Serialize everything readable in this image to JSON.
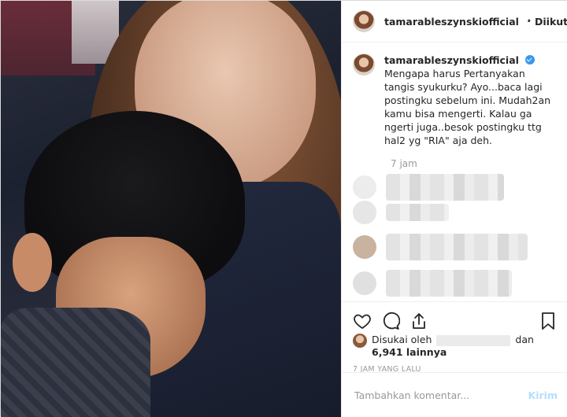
{
  "post": {
    "username": "tamarableszynskiofficial",
    "follow_label": "Diikuti",
    "dot": "•",
    "caption": "Mengapa harus Pertanyakan tangis syukurku? Ayo...baca lagi postingku sebelum ini. Mudah2an kamu bisa mengerti. Kalau ga ngerti juga..besok postingku ttg hal2 yg \"RIA\" aja deh.",
    "caption_time": "7 jam",
    "likes_prefix": "Disukai oleh",
    "likes_mid": "dan",
    "likes_count": "6,941 lainnya",
    "post_time": "7 JAM YANG LALU",
    "comment_placeholder": "Tambahkan komentar...",
    "post_button": "Kirim"
  },
  "icons": {
    "verified": "verified-badge-icon",
    "like": "heart-icon",
    "comment": "comment-icon",
    "share": "share-icon",
    "save": "bookmark-icon"
  },
  "colors": {
    "accent": "#3897f0",
    "post_button_disabled": "#b2dffc",
    "muted_text": "#999999"
  }
}
